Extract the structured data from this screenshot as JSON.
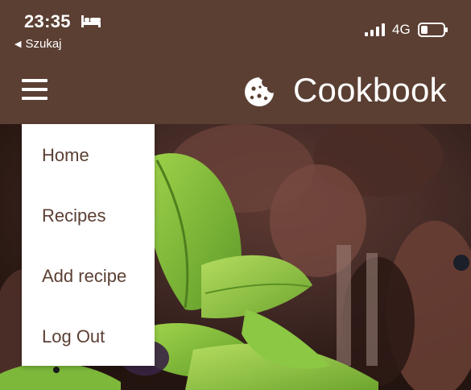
{
  "status_bar": {
    "time": "23:35",
    "back_label": "Szukaj",
    "network": "4G"
  },
  "header": {
    "title": "Cookbook",
    "menu_icon": "hamburger-icon",
    "logo_icon": "cookie-icon"
  },
  "menu": {
    "items": [
      {
        "label": "Home"
      },
      {
        "label": "Recipes"
      },
      {
        "label": "Add recipe"
      },
      {
        "label": "Log Out"
      }
    ]
  },
  "colors": {
    "brand": "#5b3f33",
    "menu_bg": "#ffffff",
    "menu_text": "#5b3f33"
  }
}
